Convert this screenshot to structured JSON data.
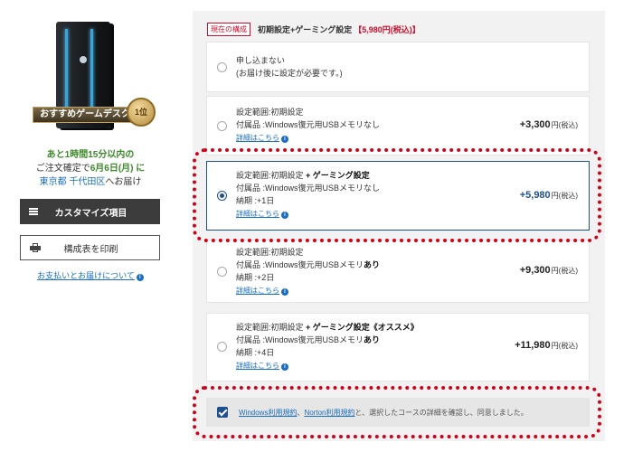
{
  "product": {
    "award_text": "おすすめゲームデスク",
    "award_rank": "1位"
  },
  "delivery": {
    "line1": "あと1時間15分以内の",
    "line2_prefix": "ご注文確定で",
    "line2_date": "6月6日(月)",
    "line2_suffix": "に",
    "line3_place": "東京都 千代田区",
    "line3_suffix": "へお届け"
  },
  "sidebar": {
    "customize_label": "カスタマイズ項目",
    "print_label": "構成表を印刷",
    "payment_link": "お支払いとお届けについて"
  },
  "current": {
    "badge": "現在の構成",
    "name": "初期設定+ゲーミング設定",
    "price": "【5,980円(税込)】"
  },
  "options": [
    {
      "line1": "申し込まない",
      "line2": "(お届け後に設定が必要です。)",
      "selected": false
    },
    {
      "line1": "設定範囲:初期設定",
      "line2": "付属品 :Windows復元用USBメモリなし",
      "link": "詳細はこちら",
      "price": "+3,300",
      "tax": "円(税込)",
      "selected": false
    },
    {
      "line1_a": "設定範囲:初期設定",
      "line1_b": " + ゲーミング設定",
      "line2": "付属品 :Windows復元用USBメモリなし",
      "line3": "納期 :+1日",
      "link": "詳細はこちら",
      "price": "+5,980",
      "tax": "円(税込)",
      "selected": true
    },
    {
      "line1": "設定範囲:初期設定",
      "line2_a": "付属品 :Windows復元用USBメモリ",
      "line2_b": "あり",
      "line3": "納期 :+2日",
      "link": "詳細はこちら",
      "price": "+9,300",
      "tax": "円(税込)",
      "selected": false
    },
    {
      "line1_a": "設定範囲:初期設定",
      "line1_b": " + ゲーミング設定《オススメ》",
      "line2_a": "付属品 :Windows復元用USBメモリ",
      "line2_b": "あり",
      "line3": "納期 :+4日",
      "link": "詳細はこちら",
      "price": "+11,980",
      "tax": "円(税込)",
      "selected": false
    }
  ],
  "agreement": {
    "link1": "Windows利用規約",
    "sep": "、",
    "link2": "Norton利用規約",
    "text": "と、選択したコースの詳細を確認し、同意しました。",
    "checked": true
  },
  "colors": {
    "accent_blue": "#1f4f8f",
    "link_blue": "#1a6ec0",
    "highlight_red": "#d0021b",
    "badge_red": "#c8102e"
  }
}
